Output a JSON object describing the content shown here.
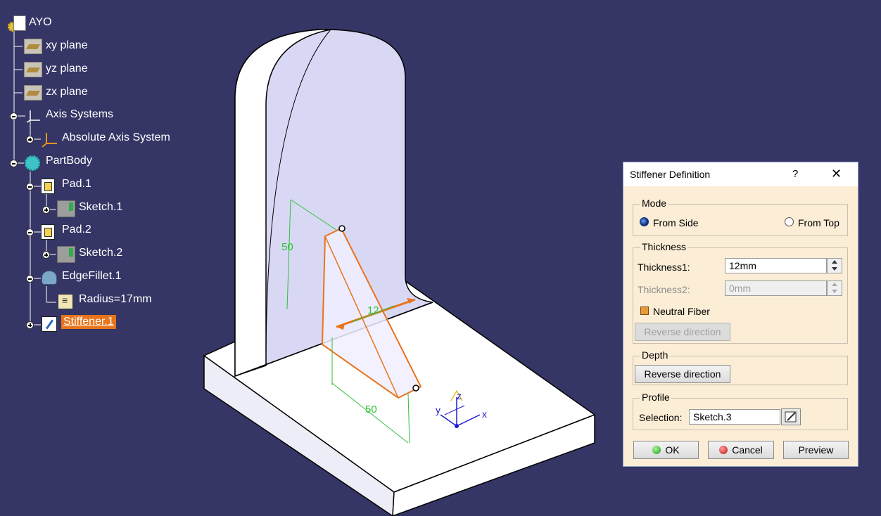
{
  "tree": {
    "root": "AYO",
    "items": [
      {
        "label": "xy plane"
      },
      {
        "label": "yz plane"
      },
      {
        "label": "zx plane"
      },
      {
        "label": "Axis Systems"
      },
      {
        "label": "Absolute Axis System"
      },
      {
        "label": "PartBody"
      },
      {
        "label": "Pad.1"
      },
      {
        "label": "Sketch.1"
      },
      {
        "label": "Pad.2"
      },
      {
        "label": "Sketch.2"
      },
      {
        "label": "EdgeFillet.1"
      },
      {
        "label": "Radius=17mm"
      },
      {
        "label": "Stiffener.1",
        "selected": true
      }
    ]
  },
  "model": {
    "dim_vertical": "50",
    "dim_horizontal": "50",
    "dim_thickness": "12",
    "axis_x": "x",
    "axis_y": "y",
    "axis_z": "z",
    "colors": {
      "background": "#353566",
      "face_front": "#ffffff",
      "face_shaded": "#d8d8f4",
      "highlight": "#e8741a",
      "dimension": "#2fc236"
    }
  },
  "dialog": {
    "title": "Stiffener Definition",
    "help": "?",
    "close": "✕",
    "mode": {
      "label": "Mode",
      "from_side": "From Side",
      "from_top": "From Top",
      "selected": "From Side"
    },
    "thickness": {
      "label": "Thickness",
      "thickness1_label": "Thickness1:",
      "thickness1_value": "12mm",
      "thickness2_label": "Thickness2:",
      "thickness2_value": "0mm",
      "neutral_fiber": "Neutral Fiber",
      "neutral_fiber_checked": true,
      "reverse": "Reverse direction"
    },
    "depth": {
      "label": "Depth",
      "reverse": "Reverse direction"
    },
    "profile": {
      "label": "Profile",
      "selection_label": "Selection:",
      "selection_value": "Sketch.3"
    },
    "buttons": {
      "ok": "OK",
      "cancel": "Cancel",
      "preview": "Preview"
    }
  }
}
